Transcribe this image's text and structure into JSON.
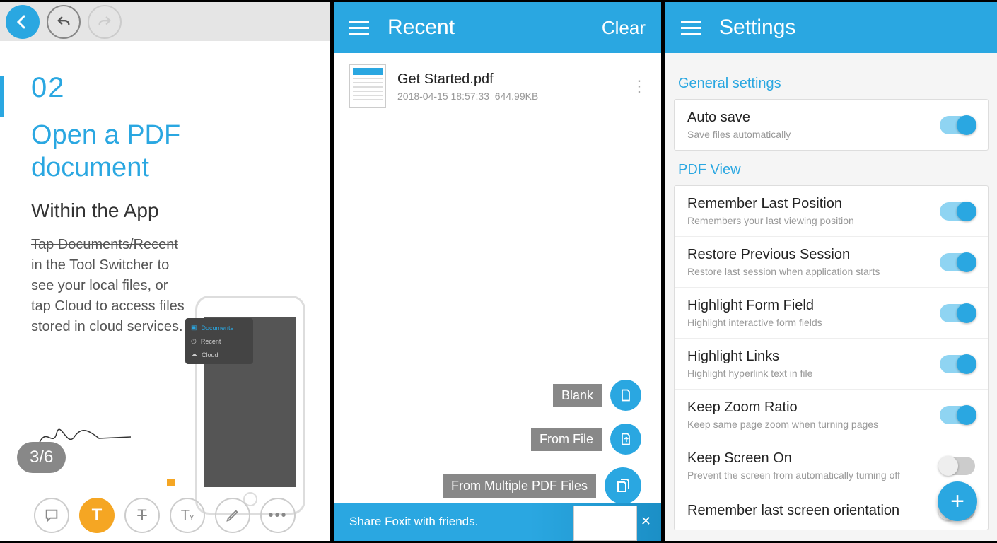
{
  "pane1": {
    "pager": "3/6",
    "doc": {
      "number": "02",
      "title_line1": "Open a PDF",
      "title_line2": "document",
      "subtitle": "Within the App",
      "para_strike": "Tap Documents/Recent",
      "para_rest": "in  the Tool Switcher to see your local files, or tap Cloud to access files stored in cloud services."
    },
    "popup": {
      "items": [
        "Documents",
        "Recent",
        "Cloud"
      ]
    }
  },
  "pane2": {
    "title": "Recent",
    "clear": "Clear",
    "file": {
      "name": "Get Started.pdf",
      "date": "2018-04-15 18:57:33",
      "size": "644.99KB"
    },
    "fab": {
      "blank": "Blank",
      "from_file": "From File",
      "from_multi": "From Multiple PDF Files"
    },
    "share": "Share Foxit with friends."
  },
  "pane3": {
    "title": "Settings",
    "sections": {
      "general": "General settings",
      "pdfview": "PDF View"
    },
    "rows": {
      "autosave": {
        "t": "Auto save",
        "d": "Save files automatically",
        "on": true
      },
      "remember": {
        "t": "Remember Last Position",
        "d": "Remembers your last viewing position",
        "on": true
      },
      "restore": {
        "t": "Restore Previous Session",
        "d": "Restore last session when application starts",
        "on": true
      },
      "form": {
        "t": "Highlight Form Field",
        "d": "Highlight interactive form fields",
        "on": true
      },
      "links": {
        "t": "Highlight Links",
        "d": "Highlight hyperlink text in file",
        "on": true
      },
      "zoom": {
        "t": "Keep Zoom Ratio",
        "d": "Keep same page zoom when turning pages",
        "on": true
      },
      "screenon": {
        "t": "Keep Screen On",
        "d": "Prevent the screen from automatically turning off",
        "on": false
      },
      "orient": {
        "t": "Remember last screen orientation",
        "d": "",
        "on": false
      }
    }
  }
}
